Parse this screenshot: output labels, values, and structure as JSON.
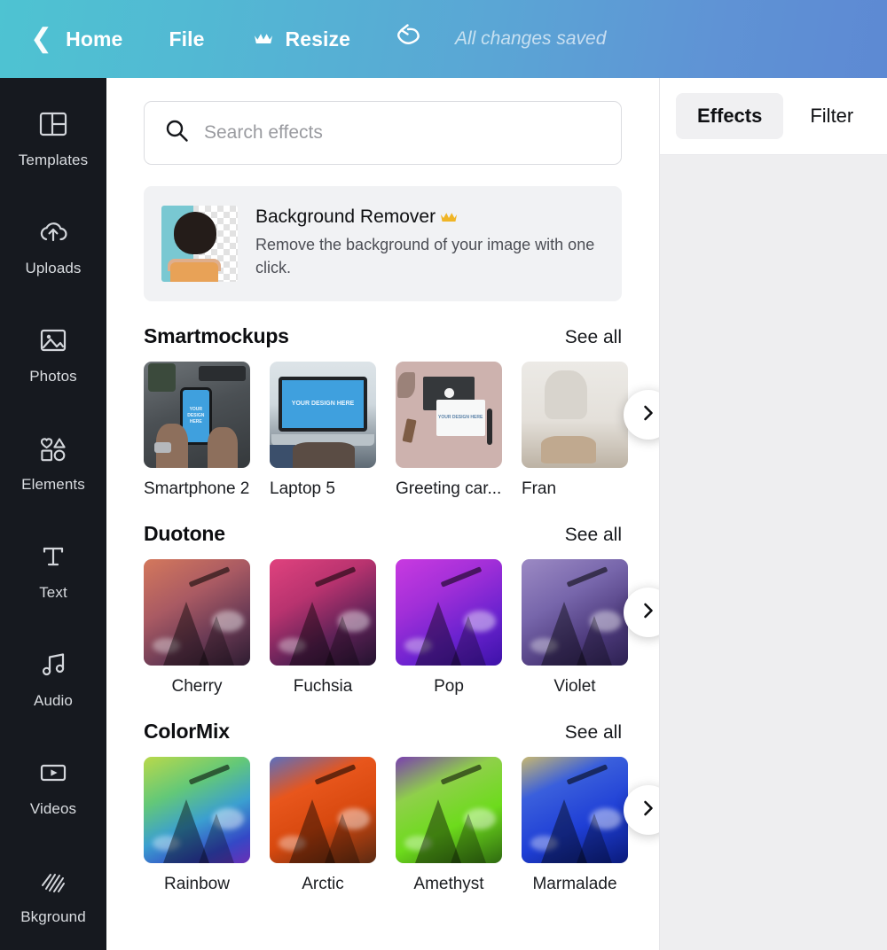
{
  "topbar": {
    "back_icon": "chevron-left-icon",
    "home_label": "Home",
    "file_label": "File",
    "resize_label": "Resize",
    "resize_crown_icon": "crown-icon",
    "undo_icon": "undo-icon",
    "status": "All changes saved"
  },
  "sidebar": {
    "items": [
      {
        "label": "Templates",
        "icon": "templates-icon"
      },
      {
        "label": "Uploads",
        "icon": "cloud-upload-icon"
      },
      {
        "label": "Photos",
        "icon": "image-icon"
      },
      {
        "label": "Elements",
        "icon": "shapes-icon"
      },
      {
        "label": "Text",
        "icon": "text-icon"
      },
      {
        "label": "Audio",
        "icon": "music-note-icon"
      },
      {
        "label": "Videos",
        "icon": "video-icon"
      },
      {
        "label": "Bkground",
        "icon": "hatch-pattern-icon"
      }
    ]
  },
  "search": {
    "placeholder": "Search effects",
    "value": "",
    "icon": "search-icon"
  },
  "promo": {
    "title": "Background Remover",
    "crown_icon": "crown-icon",
    "description": "Remove the background of your image with one click."
  },
  "sections": [
    {
      "title": "Smartmockups",
      "see_all": "See all",
      "next_icon": "chevron-right-icon",
      "items": [
        {
          "label": "Smartphone 2",
          "mockup_text": "YOUR DESIGN HERE"
        },
        {
          "label": "Laptop 5",
          "mockup_text": "YOUR DESIGN HERE"
        },
        {
          "label": "Greeting car...",
          "mockup_text": "YOUR DESIGN HERE"
        },
        {
          "label": "Fran",
          "mockup_text": ""
        }
      ]
    },
    {
      "title": "Duotone",
      "see_all": "See all",
      "next_icon": "chevron-right-icon",
      "items": [
        {
          "label": "Cherry",
          "color_a": "#d4785c",
          "color_b": "#3a2238"
        },
        {
          "label": "Fuchsia",
          "color_a": "#e0427e",
          "color_b": "#2a1636"
        },
        {
          "label": "Pop",
          "color_a": "#c93ae0",
          "color_b": "#4a17c6"
        },
        {
          "label": "Violet",
          "color_a": "#8e7bbd",
          "color_b": "#3a2a5e"
        }
      ]
    },
    {
      "title": "ColorMix",
      "see_all": "See all",
      "next_icon": "chevron-right-icon",
      "items": [
        {
          "label": "Rainbow",
          "color_a": "#8ed14e",
          "color_b": "#2b35c8"
        },
        {
          "label": "Arctic",
          "color_a": "#e8561c",
          "color_b": "#4a2a18"
        },
        {
          "label": "Amethyst",
          "color_a": "#6ddb1c",
          "color_b": "#7a3fb0"
        },
        {
          "label": "Marmalade",
          "color_a": "#2a4fe0",
          "color_b": "#0a1a7a"
        }
      ]
    }
  ],
  "right_panel": {
    "tabs": [
      {
        "label": "Effects",
        "active": true
      },
      {
        "label": "Filter",
        "active": false
      }
    ]
  },
  "colors": {
    "header_left": "#4ec3d2",
    "header_right": "#5d89d3",
    "rail_bg": "#16191f",
    "panel_bg": "#ffffff",
    "right_bg": "#eeeef0",
    "crown_gold": "#f0b526"
  }
}
